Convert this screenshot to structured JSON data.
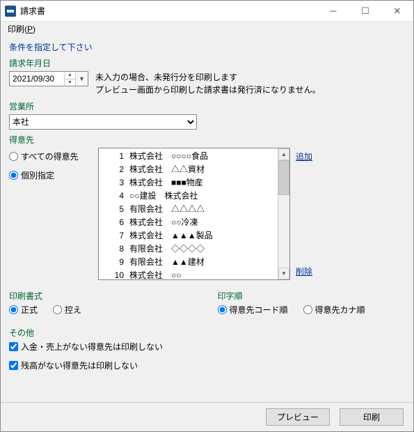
{
  "window": {
    "title": "請求書",
    "menu_print": "印刷(",
    "menu_print_key": "P",
    "menu_print_suffix": ")"
  },
  "statement": "条件を指定して下さい",
  "date": {
    "label": "請求年月日",
    "value": "2021/09/30",
    "note1": "未入力の場合、未発行分を印刷します",
    "note2": "プレビュー画面から印刷した請求書は発行済になりません。"
  },
  "office": {
    "label": "営業所",
    "value": "本社"
  },
  "customers": {
    "label": "得意先",
    "radio_all": "すべての得意先",
    "radio_individual": "個別指定",
    "selected": "individual",
    "items": [
      {
        "no": "1",
        "text": "株式会社　○○○○食品"
      },
      {
        "no": "2",
        "text": "株式会社　△△資材"
      },
      {
        "no": "3",
        "text": "株式会社　■■■物産"
      },
      {
        "no": "4",
        "text": "○○建設　株式会社"
      },
      {
        "no": "5",
        "text": "有限会社　△△△△"
      },
      {
        "no": "6",
        "text": "株式会社　○○冷凍"
      },
      {
        "no": "7",
        "text": "株式会社　▲▲▲製品"
      },
      {
        "no": "8",
        "text": "有限会社　◇◇◇◇"
      },
      {
        "no": "9",
        "text": "有限会社　▲▲建材"
      },
      {
        "no": "10",
        "text": "株式会社　○○"
      }
    ],
    "link_add": "追加",
    "link_delete": "削除"
  },
  "format": {
    "label": "印刷書式",
    "option_formal": "正式",
    "option_copy": "控え",
    "selected": "formal"
  },
  "order": {
    "label": "印字順",
    "option_code": "得意先コード順",
    "option_kana": "得意先カナ順",
    "selected": "code"
  },
  "other": {
    "label": "その他",
    "check1": "入金・売上がない得意先は印刷しない",
    "check1_checked": true,
    "check2": "残高がない得意先は印刷しない",
    "check2_checked": true
  },
  "footer": {
    "preview": "プレビュー",
    "print": "印刷"
  }
}
